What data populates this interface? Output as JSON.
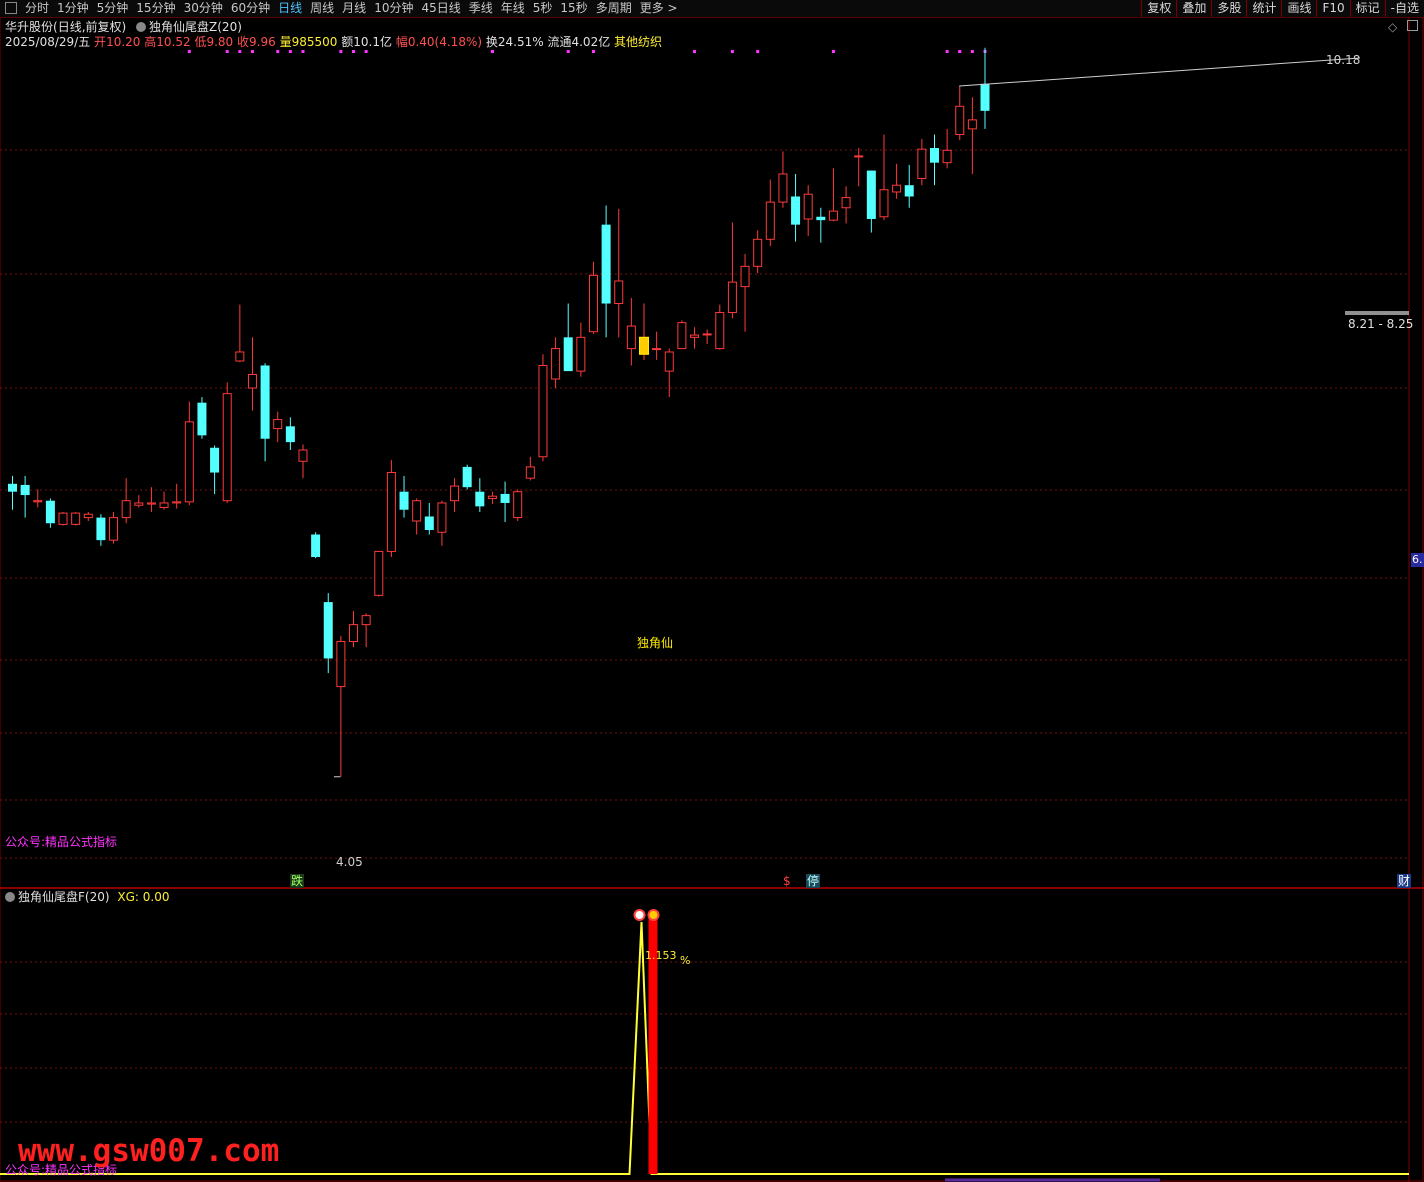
{
  "topbar": {
    "tabs": [
      {
        "label": "分时",
        "active": false
      },
      {
        "label": "1分钟",
        "active": false
      },
      {
        "label": "5分钟",
        "active": false
      },
      {
        "label": "15分钟",
        "active": false
      },
      {
        "label": "30分钟",
        "active": false
      },
      {
        "label": "60分钟",
        "active": false
      },
      {
        "label": "日线",
        "active": true
      },
      {
        "label": "周线",
        "active": false
      },
      {
        "label": "月线",
        "active": false
      },
      {
        "label": "10分钟",
        "active": false
      },
      {
        "label": "45日线",
        "active": false
      },
      {
        "label": "季线",
        "active": false
      },
      {
        "label": "年线",
        "active": false
      },
      {
        "label": "5秒",
        "active": false
      },
      {
        "label": "15秒",
        "active": false
      },
      {
        "label": "多周期",
        "active": false
      },
      {
        "label": "更多 >",
        "active": false
      }
    ],
    "right_buttons": [
      "复权",
      "叠加",
      "多股",
      "统计",
      "画线",
      "F10",
      "标记",
      "-自选"
    ]
  },
  "main_panel": {
    "stock_name": "华升股份",
    "mode": "(日线,前复权)",
    "indicator_name": "独角仙尾盘Z(20)",
    "info": {
      "date": "2025/08/29/五",
      "open_label": "开",
      "open": "10.20",
      "high_label": "高",
      "high": "10.52",
      "low_label": "低",
      "low": "9.80",
      "close_label": "收",
      "close": "9.96",
      "volume_label": "量",
      "volume": "985500",
      "amount_label": "额",
      "amount": "10.1亿",
      "change_label": "幅",
      "change": "0.40(4.18%)",
      "turnover_label": "换",
      "turnover": "24.51%",
      "float_label": "流通",
      "float": "4.02亿",
      "industry": "其他纺织"
    },
    "watermark": "公众号:精品公式指标",
    "signal_label": "独角仙",
    "high_marker": "10.18",
    "low_marker": "4.05",
    "range_box": "8.21 - 8.25",
    "right_edge_label": "6.",
    "bottom_tags": {
      "die": "跌",
      "s": "$",
      "ting": "停",
      "cai": "财"
    }
  },
  "sub_panel": {
    "indicator_name": "独角仙尾盘F(20)",
    "xg_text": "XG: 0.00",
    "peak_label": "1.153",
    "percent_sign": "%",
    "watermark": "公众号:精品公式指标",
    "site_watermark": "www.gsw007.com"
  },
  "colors": {
    "background": "#000000",
    "up": "#ff3a3a",
    "down": "#54ffff",
    "grid": "#7a1010",
    "signal": "#ffee00",
    "magenta": "#ff33ff",
    "line": "#ffff33",
    "bar": "#ff0000",
    "site": "#ff2020"
  },
  "chart_data": {
    "type": "candlestick",
    "price_range": [
      3.4,
      10.5
    ],
    "candles": [
      {
        "o": 6.65,
        "h": 6.72,
        "l": 6.42,
        "c": 6.58
      },
      {
        "o": 6.64,
        "h": 6.72,
        "l": 6.35,
        "c": 6.55
      },
      {
        "o": 6.49,
        "h": 6.6,
        "l": 6.44,
        "c": 6.5
      },
      {
        "o": 6.5,
        "h": 6.52,
        "l": 6.26,
        "c": 6.3
      },
      {
        "o": 6.29,
        "h": 6.4,
        "l": 6.28,
        "c": 6.39
      },
      {
        "o": 6.29,
        "h": 6.4,
        "l": 6.28,
        "c": 6.39
      },
      {
        "o": 6.35,
        "h": 6.4,
        "l": 6.32,
        "c": 6.38
      },
      {
        "o": 6.35,
        "h": 6.38,
        "l": 6.1,
        "c": 6.15
      },
      {
        "o": 6.15,
        "h": 6.4,
        "l": 6.12,
        "c": 6.35
      },
      {
        "o": 6.35,
        "h": 6.7,
        "l": 6.3,
        "c": 6.5
      },
      {
        "o": 6.46,
        "h": 6.55,
        "l": 6.44,
        "c": 6.48
      },
      {
        "o": 6.47,
        "h": 6.62,
        "l": 6.4,
        "c": 6.48
      },
      {
        "o": 6.44,
        "h": 6.58,
        "l": 6.42,
        "c": 6.48
      },
      {
        "o": 6.48,
        "h": 6.65,
        "l": 6.43,
        "c": 6.49
      },
      {
        "o": 6.49,
        "h": 7.38,
        "l": 6.46,
        "c": 7.2
      },
      {
        "o": 7.37,
        "h": 7.42,
        "l": 7.05,
        "c": 7.08
      },
      {
        "o": 6.97,
        "h": 6.99,
        "l": 6.56,
        "c": 6.75
      },
      {
        "o": 6.5,
        "h": 7.55,
        "l": 6.48,
        "c": 7.45
      },
      {
        "o": 7.74,
        "h": 8.24,
        "l": 7.73,
        "c": 7.82
      },
      {
        "o": 7.5,
        "h": 7.95,
        "l": 7.3,
        "c": 7.62
      },
      {
        "o": 7.7,
        "h": 7.72,
        "l": 6.85,
        "c": 7.05
      },
      {
        "o": 7.14,
        "h": 7.29,
        "l": 7.02,
        "c": 7.22
      },
      {
        "o": 7.16,
        "h": 7.24,
        "l": 6.95,
        "c": 7.02
      },
      {
        "o": 6.85,
        "h": 7.0,
        "l": 6.7,
        "c": 6.95
      },
      {
        "o": 6.2,
        "h": 6.22,
        "l": 5.99,
        "c": 6.0
      },
      {
        "o": 5.6,
        "h": 5.68,
        "l": 4.97,
        "c": 5.1
      },
      {
        "o": 4.85,
        "h": 5.3,
        "l": 4.05,
        "c": 5.25
      },
      {
        "o": 5.25,
        "h": 5.52,
        "l": 5.2,
        "c": 5.4
      },
      {
        "o": 5.4,
        "h": 5.5,
        "l": 5.2,
        "c": 5.48
      },
      {
        "o": 5.66,
        "h": 6.0,
        "l": 5.65,
        "c": 6.05
      },
      {
        "o": 6.05,
        "h": 6.86,
        "l": 6.0,
        "c": 6.75
      },
      {
        "o": 6.58,
        "h": 6.72,
        "l": 6.35,
        "c": 6.42
      },
      {
        "o": 6.32,
        "h": 6.52,
        "l": 6.2,
        "c": 6.5
      },
      {
        "o": 6.36,
        "h": 6.48,
        "l": 6.2,
        "c": 6.24
      },
      {
        "o": 6.22,
        "h": 6.5,
        "l": 6.1,
        "c": 6.48
      },
      {
        "o": 6.5,
        "h": 6.7,
        "l": 6.4,
        "c": 6.63
      },
      {
        "o": 6.8,
        "h": 6.82,
        "l": 6.6,
        "c": 6.62
      },
      {
        "o": 6.58,
        "h": 6.7,
        "l": 6.4,
        "c": 6.45
      },
      {
        "o": 6.52,
        "h": 6.58,
        "l": 6.47,
        "c": 6.54
      },
      {
        "o": 6.56,
        "h": 6.67,
        "l": 6.31,
        "c": 6.48
      },
      {
        "o": 6.35,
        "h": 6.6,
        "l": 6.32,
        "c": 6.58
      },
      {
        "o": 6.7,
        "h": 6.89,
        "l": 6.68,
        "c": 6.8
      },
      {
        "o": 6.89,
        "h": 7.8,
        "l": 6.85,
        "c": 7.7
      },
      {
        "o": 7.58,
        "h": 7.95,
        "l": 7.5,
        "c": 7.85
      },
      {
        "o": 7.95,
        "h": 8.25,
        "l": 7.7,
        "c": 7.65
      },
      {
        "o": 7.65,
        "h": 8.08,
        "l": 7.6,
        "c": 7.95
      },
      {
        "o": 8.0,
        "h": 8.62,
        "l": 7.98,
        "c": 8.5
      },
      {
        "o": 8.95,
        "h": 9.12,
        "l": 7.95,
        "c": 8.25
      },
      {
        "o": 8.25,
        "h": 9.09,
        "l": 7.95,
        "c": 8.45
      },
      {
        "o": 7.85,
        "h": 8.3,
        "l": 7.7,
        "c": 8.05
      },
      {
        "o": 7.8,
        "h": 8.25,
        "l": 7.75,
        "c": 7.95
      },
      {
        "o": 7.85,
        "h": 8.0,
        "l": 7.75,
        "c": 7.85
      },
      {
        "o": 7.65,
        "h": 7.85,
        "l": 7.42,
        "c": 7.82
      },
      {
        "o": 7.85,
        "h": 8.1,
        "l": 7.85,
        "c": 8.08
      },
      {
        "o": 7.95,
        "h": 8.04,
        "l": 7.85,
        "c": 7.97
      },
      {
        "o": 7.98,
        "h": 8.02,
        "l": 7.89,
        "c": 7.98
      },
      {
        "o": 7.85,
        "h": 8.24,
        "l": 7.84,
        "c": 8.17
      },
      {
        "o": 8.17,
        "h": 8.97,
        "l": 8.12,
        "c": 8.44
      },
      {
        "o": 8.4,
        "h": 8.69,
        "l": 8.0,
        "c": 8.58
      },
      {
        "o": 8.58,
        "h": 8.9,
        "l": 8.52,
        "c": 8.82
      },
      {
        "o": 8.82,
        "h": 9.35,
        "l": 8.76,
        "c": 9.15
      },
      {
        "o": 9.15,
        "h": 9.6,
        "l": 9.1,
        "c": 9.4
      },
      {
        "o": 9.2,
        "h": 9.4,
        "l": 8.8,
        "c": 8.95
      },
      {
        "o": 9.0,
        "h": 9.3,
        "l": 8.85,
        "c": 9.22
      },
      {
        "o": 9.02,
        "h": 9.1,
        "l": 8.79,
        "c": 8.99
      },
      {
        "o": 8.99,
        "h": 9.45,
        "l": 8.98,
        "c": 9.07
      },
      {
        "o": 9.1,
        "h": 9.29,
        "l": 8.96,
        "c": 9.19
      },
      {
        "o": 9.56,
        "h": 9.63,
        "l": 9.29,
        "c": 9.56
      },
      {
        "o": 9.43,
        "h": 9.43,
        "l": 8.88,
        "c": 9.0
      },
      {
        "o": 9.02,
        "h": 9.75,
        "l": 8.99,
        "c": 9.26
      },
      {
        "o": 9.24,
        "h": 9.49,
        "l": 9.18,
        "c": 9.3
      },
      {
        "o": 9.3,
        "h": 9.48,
        "l": 9.1,
        "c": 9.2
      },
      {
        "o": 9.36,
        "h": 9.71,
        "l": 9.3,
        "c": 9.62
      },
      {
        "o": 9.63,
        "h": 9.75,
        "l": 9.3,
        "c": 9.5
      },
      {
        "o": 9.5,
        "h": 9.8,
        "l": 9.45,
        "c": 9.61
      },
      {
        "o": 9.75,
        "h": 10.18,
        "l": 9.7,
        "c": 10.0
      },
      {
        "o": 9.8,
        "h": 10.08,
        "l": 9.4,
        "c": 9.88
      },
      {
        "o": 10.2,
        "h": 10.52,
        "l": 9.8,
        "c": 9.96
      }
    ],
    "subchart": {
      "peak_index": 50,
      "peak_value": 1.153
    }
  }
}
